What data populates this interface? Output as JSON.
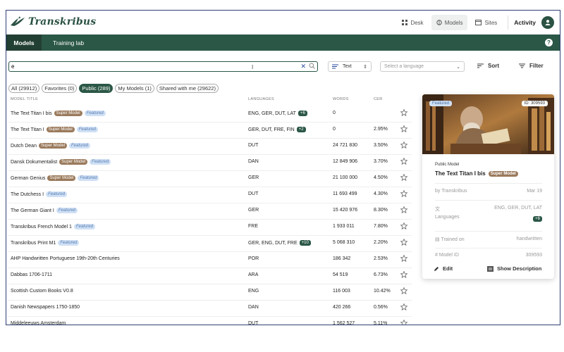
{
  "app": {
    "brand": "Transkribus",
    "nav": [
      {
        "label": "Desk",
        "icon": "grid-icon"
      },
      {
        "label": "Models",
        "icon": "brain-icon"
      },
      {
        "label": "Sites",
        "icon": "window-icon"
      }
    ],
    "activity": "Activity"
  },
  "subnav": {
    "tabs": [
      "Models",
      "Training lab"
    ],
    "active": "Models"
  },
  "search": {
    "value": "e",
    "clear": "✕"
  },
  "toolbar": {
    "type_select": "Text",
    "language_placeholder": "Select a language",
    "sort": "Sort",
    "filter": "Filter"
  },
  "filters": [
    "All (29912)",
    "Favorites (0)",
    "Public (289)",
    "My Models (1)",
    "Shared with me (29622)"
  ],
  "table": {
    "headers": {
      "title": "MODEL TITLE",
      "languages": "LANGUAGES",
      "words": "WORDS",
      "cer": "CER"
    },
    "badges": {
      "super": "Super Model",
      "featured": "Featured"
    },
    "rows": [
      {
        "title": "The Text Titan I bis",
        "super": true,
        "featured": true,
        "languages": "ENG, GER, DUT, LAT",
        "more": "+6",
        "words": "0",
        "cer": ""
      },
      {
        "title": "The Text Titan I",
        "super": true,
        "featured": true,
        "languages": "GER, DUT, FRE, FIN",
        "more": "+2",
        "words": "0",
        "cer": "2.95%"
      },
      {
        "title": "Dutch Dean",
        "super": true,
        "featured": true,
        "languages": "DUT",
        "more": "",
        "words": "24 721 830",
        "cer": "3.50%"
      },
      {
        "title": "Dansk Dokumentalist",
        "super": true,
        "featured": true,
        "languages": "DAN",
        "more": "",
        "words": "12 849 906",
        "cer": "3.70%"
      },
      {
        "title": "German Genius",
        "super": true,
        "featured": true,
        "languages": "GER",
        "more": "",
        "words": "21 100 000",
        "cer": "4.50%"
      },
      {
        "title": "The Dutchess I",
        "super": false,
        "featured": true,
        "languages": "DUT",
        "more": "",
        "words": "11 693 499",
        "cer": "4.30%"
      },
      {
        "title": "The German Giant I",
        "super": false,
        "featured": true,
        "languages": "GER",
        "more": "",
        "words": "15 420 976",
        "cer": "8.30%"
      },
      {
        "title": "Transkribus French Model 1",
        "super": false,
        "featured": true,
        "languages": "FRE",
        "more": "",
        "words": "1 933 011",
        "cer": "7.80%"
      },
      {
        "title": "Transkribus Print M1",
        "super": false,
        "featured": true,
        "languages": "GER, ENG, DUT, FRE",
        "more": "+10",
        "words": "5 068 310",
        "cer": "2.20%"
      },
      {
        "title": "AHP Handwritten Portuguese 19th-20th Centuries",
        "super": false,
        "featured": false,
        "languages": "POR",
        "more": "",
        "words": "186 342",
        "cer": "2.53%"
      },
      {
        "title": "Dabbas 1706-1711",
        "super": false,
        "featured": false,
        "languages": "ARA",
        "more": "",
        "words": "54 519",
        "cer": "6.73%"
      },
      {
        "title": "Scottish Custom Books V0.8",
        "super": false,
        "featured": false,
        "languages": "ENG",
        "more": "",
        "words": "116 003",
        "cer": "10.42%"
      },
      {
        "title": "Danish Newspapers 1750-1850",
        "super": false,
        "featured": false,
        "languages": "DAN",
        "more": "",
        "words": "420 266",
        "cer": "0.56%"
      },
      {
        "title": "Middeleeuws Amsterdam",
        "super": false,
        "featured": false,
        "languages": "DUT",
        "more": "",
        "words": "1 562 527",
        "cer": "5.11%"
      }
    ]
  },
  "card": {
    "featured": "Featured",
    "id_badge": "ID: 309593",
    "kind": "Public Model",
    "title": "The Text Titan I bis",
    "super": "Super Model",
    "by": "by Transkribus",
    "date": "Mar 19",
    "languages_label": "Languages",
    "languages_value": "ENG, GER, DUT, LAT",
    "languages_more": "+6",
    "trained_label": "Trained on",
    "trained_value": "handwritten",
    "id_label": "Model ID",
    "id_value": "309593",
    "edit": "Edit",
    "show_desc": "Show Description"
  },
  "colors": {
    "brand": "#2b5746",
    "super": "#9a7a5c",
    "featured_bg": "#cfe0f4"
  }
}
